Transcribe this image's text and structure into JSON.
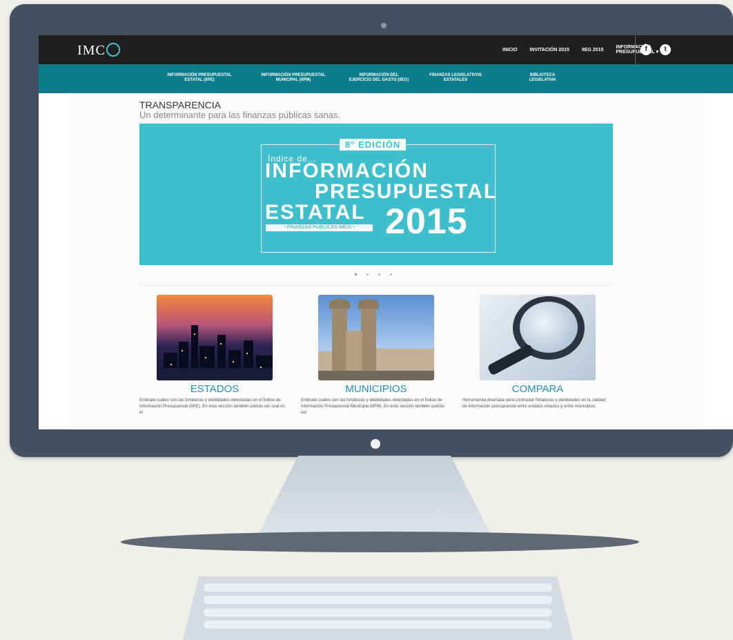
{
  "site": {
    "logo": "IMC",
    "top_nav": [
      "INICIO",
      "INVITACIÓN 2015",
      "IIEG 2015",
      "INFORMACIÓN\nPRESUPUESTAL ▾"
    ],
    "social": [
      "f",
      "t"
    ],
    "sub_nav": [
      "INFORMACIÓN PRESUPUESTAL\nESTATAL (IIPE)",
      "INFORMACIÓN PRESUPUESTAL\nMUNICIPAL (IIPM)",
      "INFORMACIÓN DEL\nEJERCICIO DEL GASTO (IIEG)",
      "FINANZAS LEGISLATIVOS\nESTATALES",
      "BIBLIOTECA\nLEGISLATIVA"
    ]
  },
  "hero": {
    "title": "TRANSPARENCIA",
    "subtitle": "Un determinante para las finanzas públicas sanas."
  },
  "banner": {
    "edition": "8° EDICIÓN",
    "indice": "Índice de...",
    "line1": "INFORMACIÓN",
    "line2": "PRESUPUESTAL",
    "line3": "ESTATAL",
    "tag": "• FINANZAS PÚBLICAS IMCO •",
    "year": "2015"
  },
  "cards": [
    {
      "title": "ESTADOS",
      "text": "Entérate cuáles son las fortalezas y debilidades detectadas en el Índice de Información Presupuestal (IIPE). En esta sección también podrás ver cuál es el"
    },
    {
      "title": "MUNICIPIOS",
      "text": "Entérate cuáles son las fortalezas y debilidades detectadas en el Índice de Información Presupuestal Municipal (IIPM). En esta sección también podrás ver"
    },
    {
      "title": "COMPARA",
      "text": "Herramienta diseñada para contrastar fortalezas y debilidades en la calidad de información presupuestal entre estados estados y entre municipios."
    }
  ]
}
